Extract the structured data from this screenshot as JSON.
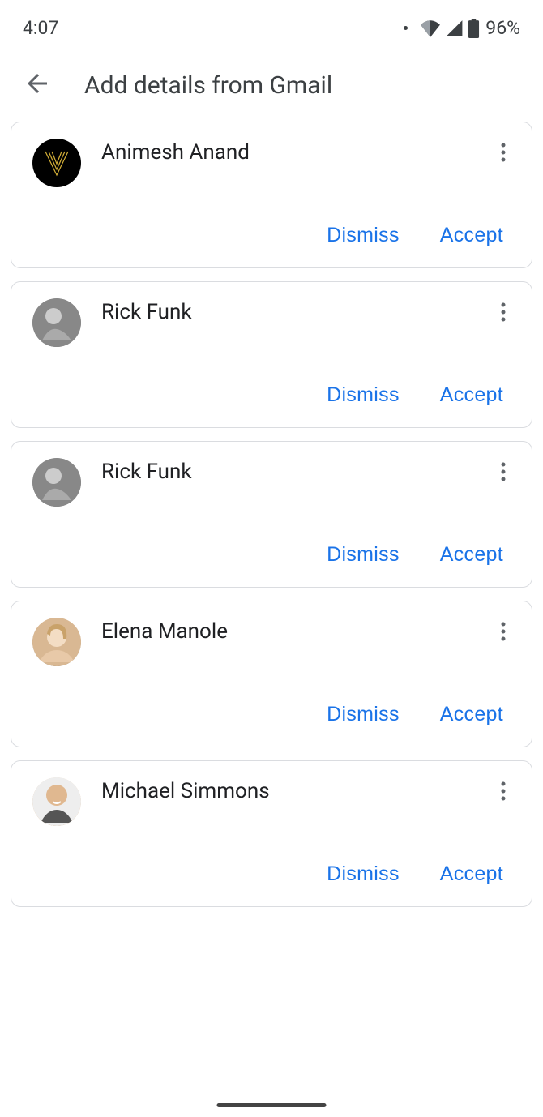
{
  "status": {
    "time": "4:07",
    "battery": "96%"
  },
  "toolbar": {
    "title": "Add details from Gmail"
  },
  "contacts": [
    {
      "name": "Animesh Anand"
    },
    {
      "name": "Rick Funk"
    },
    {
      "name": "Rick Funk"
    },
    {
      "name": "Elena Manole"
    },
    {
      "name": "Michael Simmons"
    }
  ],
  "actions": {
    "dismiss": "Dismiss",
    "accept": "Accept"
  }
}
